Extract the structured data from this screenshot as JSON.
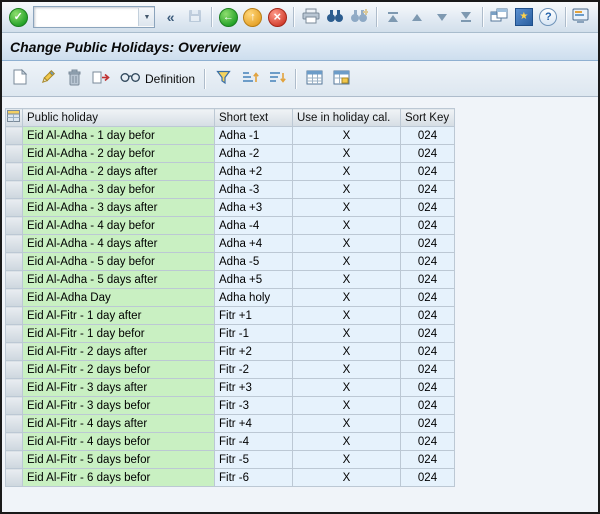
{
  "title": "Change Public Holidays: Overview",
  "toolbar": {
    "command_value": ""
  },
  "icons": {
    "check": "✓",
    "dropdown": "▼",
    "chevrons": "«",
    "back_arrow": "←",
    "exit_arrow": "↑",
    "cancel_x": "×",
    "star": "★",
    "help": "?"
  },
  "app_toolbar": {
    "definition_label": "Definition"
  },
  "table": {
    "columns": [
      "Public holiday",
      "Short text",
      "Use in holiday cal.",
      "Sort Key"
    ],
    "rows": [
      [
        "Eid Al-Adha - 1 day befor",
        "Adha -1",
        "X",
        "024"
      ],
      [
        "Eid Al-Adha - 2 day befor",
        "Adha -2",
        "X",
        "024"
      ],
      [
        "Eid Al-Adha - 2 days after",
        "Adha +2",
        "X",
        "024"
      ],
      [
        "Eid Al-Adha - 3 day befor",
        "Adha -3",
        "X",
        "024"
      ],
      [
        "Eid Al-Adha - 3 days after",
        "Adha +3",
        "X",
        "024"
      ],
      [
        "Eid Al-Adha - 4 day befor",
        "Adha -4",
        "X",
        "024"
      ],
      [
        "Eid Al-Adha - 4 days after",
        "Adha +4",
        "X",
        "024"
      ],
      [
        "Eid Al-Adha - 5 day befor",
        "Adha -5",
        "X",
        "024"
      ],
      [
        "Eid Al-Adha - 5 days after",
        "Adha +5",
        "X",
        "024"
      ],
      [
        "Eid Al-Adha Day",
        "Adha holy",
        "X",
        "024"
      ],
      [
        "Eid Al-Fitr - 1 day after",
        "Fitr +1",
        "X",
        "024"
      ],
      [
        "Eid Al-Fitr - 1 day befor",
        "Fitr -1",
        "X",
        "024"
      ],
      [
        "Eid Al-Fitr - 2 days after",
        "Fitr +2",
        "X",
        "024"
      ],
      [
        "Eid Al-Fitr - 2 days befor",
        "Fitr -2",
        "X",
        "024"
      ],
      [
        "Eid Al-Fitr - 3 days after",
        "Fitr +3",
        "X",
        "024"
      ],
      [
        "Eid Al-Fitr - 3 days befor",
        "Fitr -3",
        "X",
        "024"
      ],
      [
        "Eid Al-Fitr - 4 days after",
        "Fitr +4",
        "X",
        "024"
      ],
      [
        "Eid Al-Fitr - 4 days befor",
        "Fitr -4",
        "X",
        "024"
      ],
      [
        "Eid Al-Fitr - 5 days befor",
        "Fitr -5",
        "X",
        "024"
      ],
      [
        "Eid Al-Fitr - 6 days befor",
        "Fitr -6",
        "X",
        "024"
      ]
    ]
  }
}
